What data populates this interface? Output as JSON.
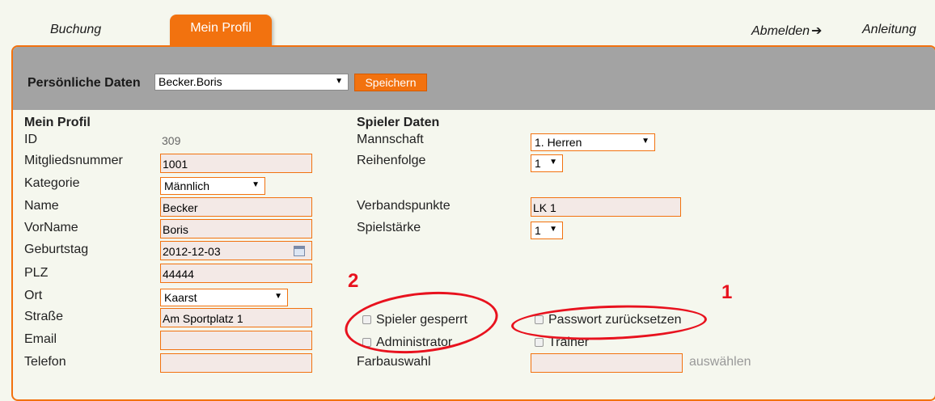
{
  "nav": {
    "booking": "Buchung",
    "profile_tab": "Mein Profil",
    "logout": "Abmelden",
    "manual": "Anleitung"
  },
  "header": {
    "title": "Persönliche Daten",
    "user_select": "Becker.Boris",
    "save": "Speichern"
  },
  "profile": {
    "heading": "Mein Profil",
    "fields": {
      "id_label": "ID",
      "id_value": "309",
      "member_no_label": "Mitgliedsnummer",
      "member_no_value": "1001",
      "category_label": "Kategorie",
      "category_value": "Männlich",
      "name_label": "Name",
      "name_value": "Becker",
      "firstname_label": "VorName",
      "firstname_value": "Boris",
      "birthday_label": "Geburtstag",
      "birthday_value": "2012-12-03",
      "zip_label": "PLZ",
      "zip_value": "44444",
      "city_label": "Ort",
      "city_value": "Kaarst",
      "street_label": "Straße",
      "street_value": "Am Sportplatz 1",
      "email_label": "Email",
      "email_value": "",
      "phone_label": "Telefon",
      "phone_value": ""
    }
  },
  "player": {
    "heading": "Spieler Daten",
    "team_label": "Mannschaft",
    "team_value": "1. Herren",
    "order_label": "Reihenfolge",
    "order_value": "1",
    "points_label": "Verbandspunkte",
    "points_value": "LK 1",
    "strength_label": "Spielstärke",
    "strength_value": "1",
    "blocked": "Spieler gesperrt",
    "reset_password": "Passwort zurücksetzen",
    "admin": "Administrator",
    "trainer": "Trainer",
    "color_label": "Farbauswahl",
    "color_pick": "auswählen"
  },
  "annotations": {
    "one": "1",
    "two": "2"
  },
  "colors": {
    "accent": "#f2720f",
    "annotation": "#e8121e",
    "header_bg": "#a3a3a3",
    "page_bg": "#f5f7ee"
  }
}
